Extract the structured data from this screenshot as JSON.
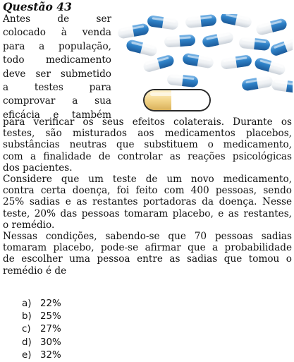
{
  "question": {
    "title": "Questão 43",
    "intro_lines": [
      "Antes de ser",
      "colocado à venda",
      "para a população,",
      "todo medicamento",
      "deve ser submetido",
      "a testes para",
      "comprovar a sua",
      "eficácia e também"
    ],
    "p1_lines": [
      "para verificar os seus efeitos colaterais. Durante os",
      "testes, são misturados aos medicamentos placebos,",
      "substâncias neutras que substituem o medicamento,",
      "com a finalidade de controlar as reações psicológicas",
      "dos pacientes."
    ],
    "p2_lines": [
      "Considere que um teste de um novo medicamento,",
      "contra certa doença, foi feito com 400 pessoas, sendo",
      "25% sadias e as restantes portadoras da doença. Nesse",
      "teste, 20% das pessoas tomaram placebo, e as restantes,",
      "o remédio."
    ],
    "p3_lines": [
      "Nessas condições, sabendo-se que 70 pessoas sadias",
      "tomaram placebo, pode-se afirmar que a probabilidade",
      "de escolher uma pessoa entre as sadias que tomou o",
      "remédio é de"
    ],
    "options": [
      {
        "letter": "a)",
        "value": "22%"
      },
      {
        "letter": "b)",
        "value": "25%"
      },
      {
        "letter": "c)",
        "value": "27%"
      },
      {
        "letter": "d)",
        "value": "30%"
      },
      {
        "letter": "e)",
        "value": "32%"
      }
    ]
  },
  "colors": {
    "capsule_blue": "#2f82c8",
    "capsule_white": "#f4f6f8",
    "capsule_yellow": "#f3d58a"
  }
}
